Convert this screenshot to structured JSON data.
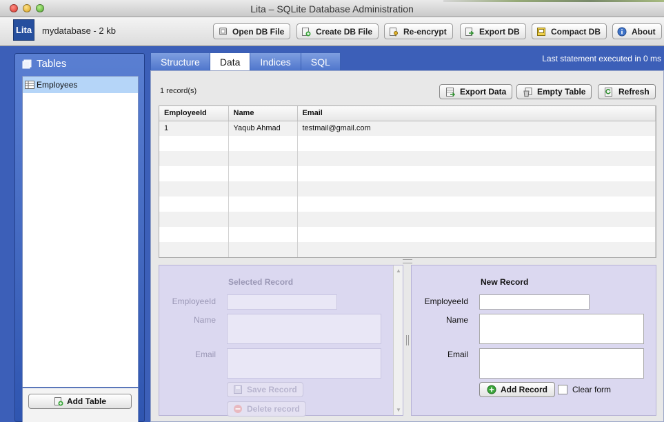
{
  "window": {
    "title": "Lita – SQLite Database Administration"
  },
  "app": {
    "logo_text": "Lita",
    "db_info": "mydatabase - 2 kb"
  },
  "toolbar": {
    "open_db": "Open DB File",
    "create_db": "Create DB File",
    "reencrypt": "Re-encrypt",
    "export_db": "Export DB",
    "compact_db": "Compact DB",
    "about": "About"
  },
  "sidebar": {
    "heading": "Tables",
    "tables": [
      {
        "label": "Employees"
      }
    ],
    "add_table": "Add Table"
  },
  "tabs": [
    {
      "label": "Structure"
    },
    {
      "label": "Data"
    },
    {
      "label": "Indices"
    },
    {
      "label": "SQL"
    }
  ],
  "active_tab": "Data",
  "status": {
    "last_statement": "Last statement executed in 0 ms"
  },
  "data_view": {
    "record_count": "1 record(s)",
    "export_data": "Export Data",
    "empty_table": "Empty Table",
    "refresh": "Refresh",
    "columns": [
      "EmployeeId",
      "Name",
      "Email"
    ],
    "rows": [
      [
        "1",
        "Yaqub Ahmad",
        "testmail@gmail.com"
      ]
    ]
  },
  "selected_record": {
    "title": "Selected Record",
    "fields": [
      "EmployeeId",
      "Name",
      "Email"
    ],
    "save": "Save Record",
    "delete": "Delete record"
  },
  "new_record": {
    "title": "New Record",
    "fields": [
      "EmployeeId",
      "Name",
      "Email"
    ],
    "add": "Add Record",
    "clear_form": "Clear form"
  },
  "colors": {
    "accent": "#3c5fb8",
    "selection": "#b5d5f8",
    "record_panel": "#dbd8f0"
  }
}
